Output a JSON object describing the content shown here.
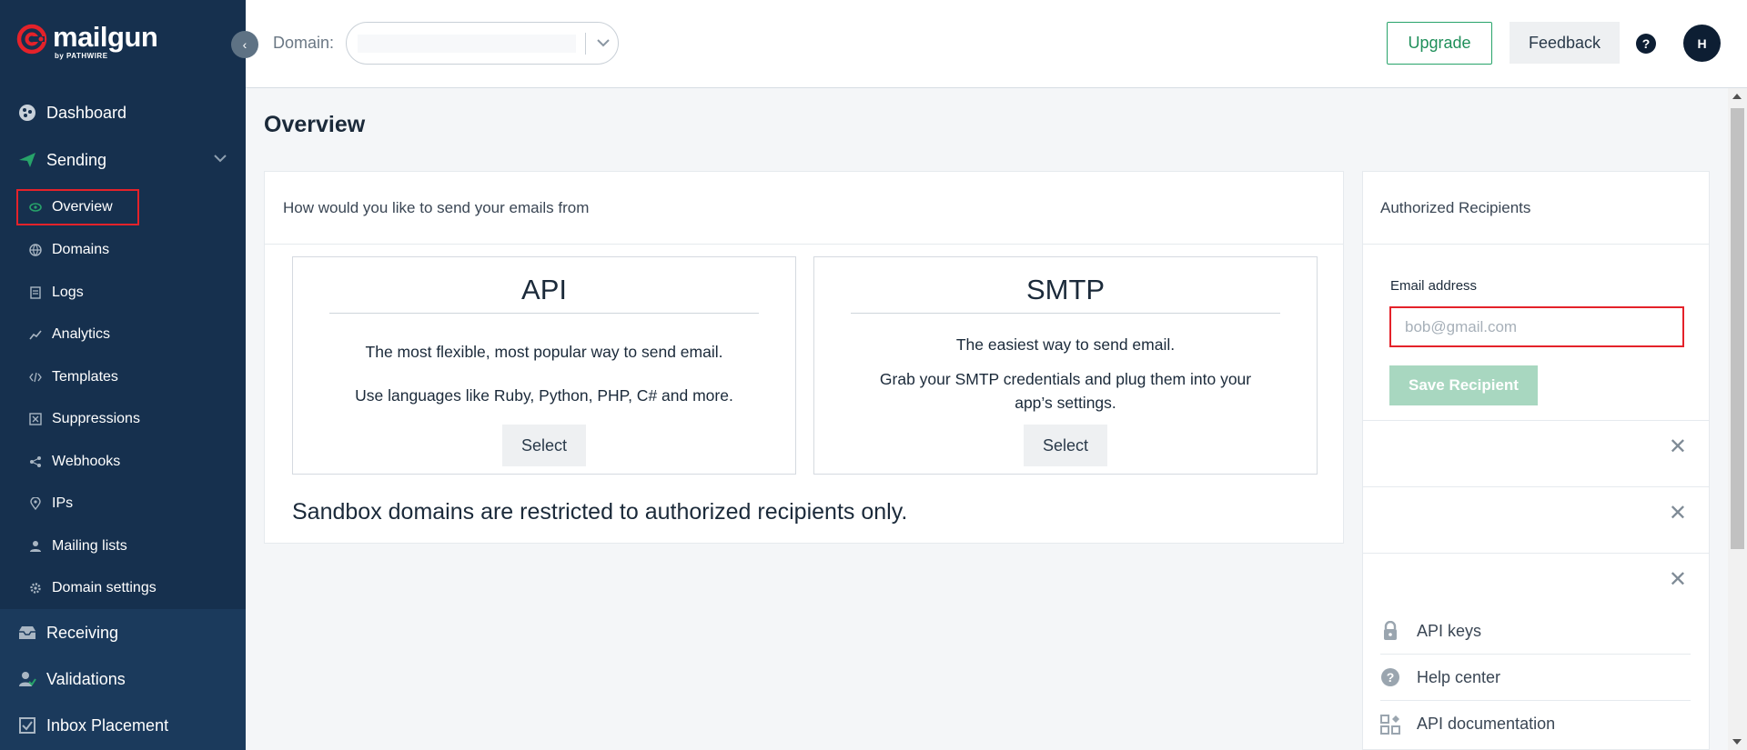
{
  "brand": {
    "name": "mailgun",
    "byline": "by PATHWIRE",
    "accent": "#e4222a",
    "green": "#27a36a"
  },
  "sidebar": {
    "collapse_icon": "chevron-left-icon",
    "top_items": [
      {
        "label": "Dashboard",
        "icon": "dashboard-icon"
      },
      {
        "label": "Sending",
        "icon": "paper-plane-icon"
      }
    ],
    "sending_items": [
      {
        "label": "Overview",
        "icon": "eye-icon"
      },
      {
        "label": "Domains",
        "icon": "globe-icon"
      },
      {
        "label": "Logs",
        "icon": "document-icon"
      },
      {
        "label": "Analytics",
        "icon": "chart-icon"
      },
      {
        "label": "Templates",
        "icon": "code-icon"
      },
      {
        "label": "Suppressions",
        "icon": "block-icon"
      },
      {
        "label": "Webhooks",
        "icon": "share-icon"
      },
      {
        "label": "IPs",
        "icon": "location-pin-icon"
      },
      {
        "label": "Mailing lists",
        "icon": "user-icon"
      },
      {
        "label": "Domain settings",
        "icon": "gear-icon"
      }
    ],
    "lower_items": [
      {
        "label": "Receiving",
        "icon": "inbox-icon"
      },
      {
        "label": "Validations",
        "icon": "user-check-icon"
      },
      {
        "label": "Inbox Placement",
        "icon": "checkbox-icon"
      }
    ]
  },
  "topbar": {
    "domain_label": "Domain:",
    "domain_value": "",
    "upgrade_label": "Upgrade",
    "feedback_label": "Feedback",
    "help_label": "?",
    "avatar_initial": "H"
  },
  "main": {
    "title": "Overview",
    "card_heading": "How would you like to send your emails from",
    "options": [
      {
        "title": "API",
        "lines": [
          "The most flexible, most popular way to send email.",
          "Use languages like Ruby, Python, PHP, C# and more."
        ],
        "button": "Select"
      },
      {
        "title": "SMTP",
        "lines": [
          "The easiest way to send email.",
          "Grab your SMTP credentials and plug them into your app’s settings."
        ],
        "button": "Select"
      }
    ],
    "sandbox_note": "Sandbox domains are restricted to authorized recipients only."
  },
  "recipients": {
    "heading": "Authorized Recipients",
    "email_label": "Email address",
    "email_placeholder": "bob@gmail.com",
    "email_value": "",
    "save_label": "Save Recipient",
    "items": [
      "",
      "",
      ""
    ],
    "close_glyph": "✕"
  },
  "links": [
    {
      "label": "API keys",
      "icon": "lock-icon"
    },
    {
      "label": "Help center",
      "icon": "help-circle-icon"
    },
    {
      "label": "API documentation",
      "icon": "grid-icon"
    }
  ]
}
